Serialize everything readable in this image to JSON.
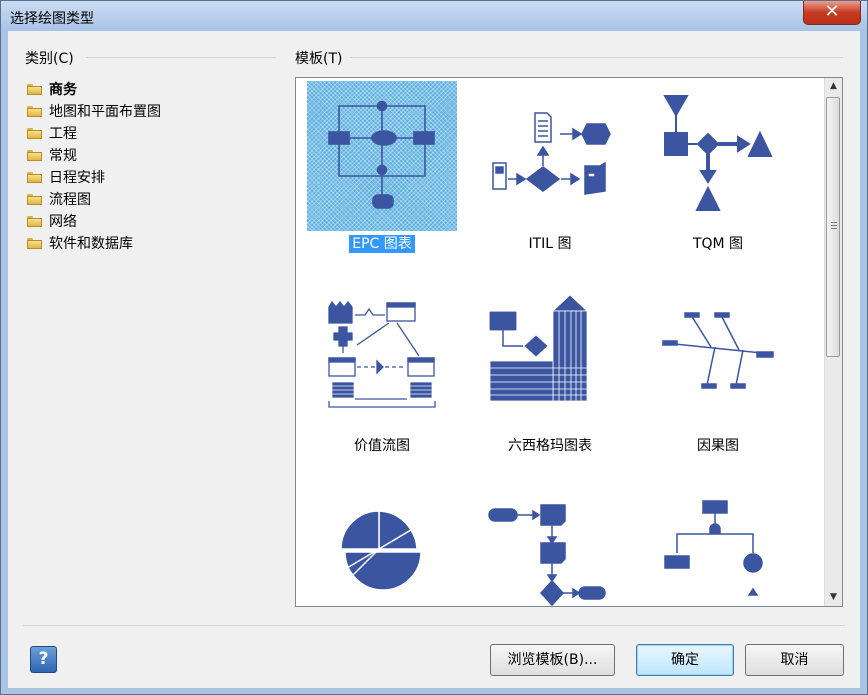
{
  "window": {
    "title": "选择绘图类型",
    "close_glyph": "✕"
  },
  "categories": {
    "label": "类别(C)",
    "items": [
      {
        "label": "商务",
        "selected": true
      },
      {
        "label": "地图和平面布置图"
      },
      {
        "label": "工程"
      },
      {
        "label": "常规"
      },
      {
        "label": "日程安排"
      },
      {
        "label": "流程图"
      },
      {
        "label": "网络"
      },
      {
        "label": "软件和数据库"
      }
    ]
  },
  "templates": {
    "label": "模板(T)",
    "items": [
      {
        "label": "EPC 图表",
        "icon": "epc-diagram-icon",
        "selected": true
      },
      {
        "label": "ITIL 图",
        "icon": "itil-diagram-icon"
      },
      {
        "label": "TQM 图",
        "icon": "tqm-diagram-icon"
      },
      {
        "label": "价值流图",
        "icon": "value-stream-map-icon"
      },
      {
        "label": "六西格玛图表",
        "icon": "six-sigma-diagram-icon"
      },
      {
        "label": "因果图",
        "icon": "cause-effect-diagram-icon"
      },
      {
        "label": "",
        "icon": "pie-chart-icon"
      },
      {
        "label": "",
        "icon": "cross-functional-flowchart-icon"
      },
      {
        "label": "",
        "icon": "fault-tree-icon"
      }
    ]
  },
  "buttons": {
    "help": "?",
    "browse": "浏览模板(B)...",
    "ok": "确定",
    "cancel": "取消"
  },
  "colors": {
    "accent": "#3b55a0",
    "selection": "#3399ff"
  }
}
